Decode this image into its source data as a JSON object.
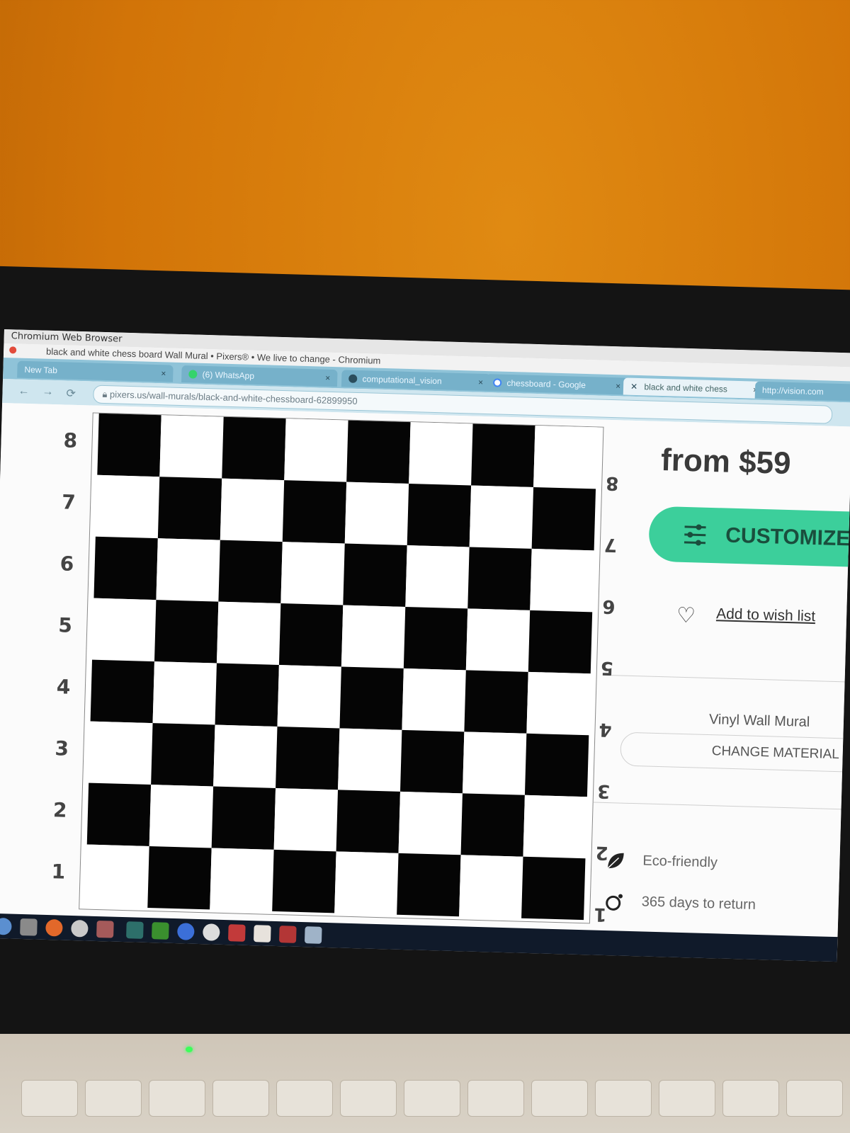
{
  "window": {
    "app_title": "Chromium Web Browser",
    "page_title": "black and white chess board Wall Mural • Pixers® • We live to change - Chromium"
  },
  "tabs": [
    {
      "label": "New Tab"
    },
    {
      "label": "(6) WhatsApp"
    },
    {
      "label": "computational_vision"
    },
    {
      "label": "chessboard - Google"
    },
    {
      "label": "black and white chess"
    },
    {
      "label": "http://vision.com"
    }
  ],
  "url": "pixers.us/wall-murals/black-and-white-chessboard-62899950",
  "board": {
    "ranks": [
      "8",
      "7",
      "6",
      "5",
      "4",
      "3",
      "2",
      "1"
    ],
    "pattern": [
      [
        "b",
        "w",
        "b",
        "w",
        "b",
        "w",
        "b",
        "w"
      ],
      [
        "w",
        "b",
        "w",
        "b",
        "w",
        "b",
        "w",
        "b"
      ],
      [
        "b",
        "w",
        "b",
        "w",
        "b",
        "w",
        "b",
        "w"
      ],
      [
        "w",
        "b",
        "w",
        "b",
        "w",
        "b",
        "w",
        "b"
      ],
      [
        "b",
        "w",
        "b",
        "w",
        "b",
        "w",
        "b",
        "w"
      ],
      [
        "w",
        "b",
        "w",
        "b",
        "w",
        "b",
        "w",
        "b"
      ],
      [
        "b",
        "w",
        "b",
        "w",
        "b",
        "w",
        "b",
        "w"
      ],
      [
        "w",
        "b",
        "w",
        "b",
        "w",
        "b",
        "w",
        "b"
      ]
    ]
  },
  "product": {
    "price": "from $59",
    "customize_label": "CUSTOMIZE",
    "wishlist_label": "Add to wish list",
    "material": "Vinyl Wall Mural",
    "change_material_label": "CHANGE MATERIAL",
    "features": [
      "Eco-friendly",
      "365 days to return"
    ]
  },
  "colors": {
    "accent": "#3ccf9b",
    "tabbar": "#8fc3d8",
    "wall": "#d27408"
  }
}
